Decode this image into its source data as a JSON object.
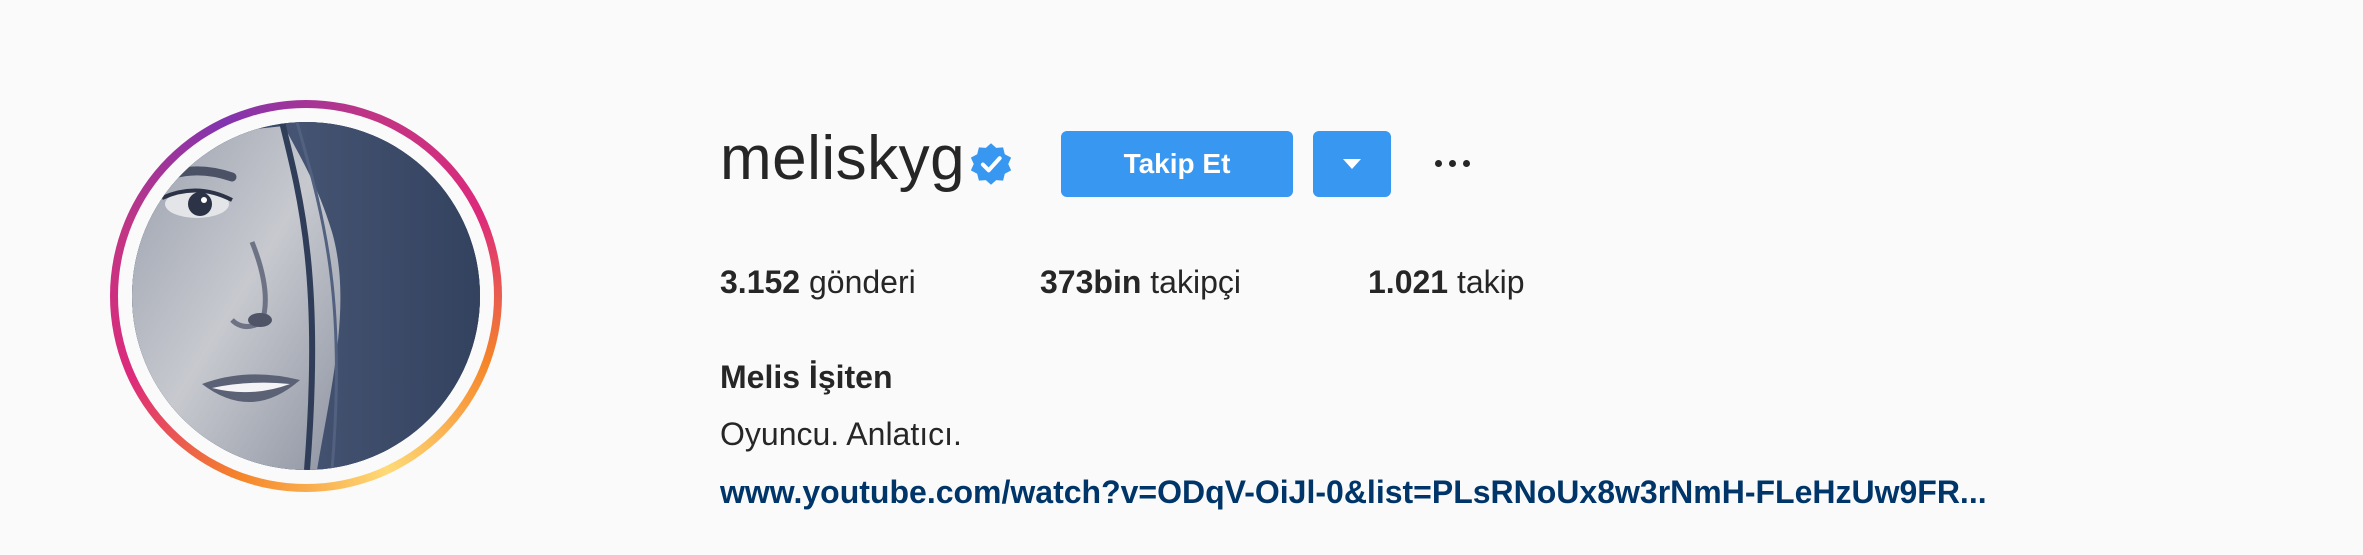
{
  "profile": {
    "username": "meliskyg",
    "verified": true,
    "full_name": "Melis İşiten",
    "bio": "Oyuncu. Anlatıcı.",
    "link": "www.youtube.com/watch?v=ODqV-OiJl-0&list=PLsRNoUx8w3rNmH-FLeHzUw9FR...",
    "avatar_icon": "profile-photo"
  },
  "actions": {
    "follow_label": "Takip Et",
    "dropdown_icon": "chevron-down-icon",
    "options_icon": "more-options-icon"
  },
  "stats": {
    "posts_count": "3.152",
    "posts_label": "gönderi",
    "followers_count": "373bin",
    "followers_label": "takipçi",
    "following_count": "1.021",
    "following_label": "takip"
  },
  "colors": {
    "accent": "#3897f0",
    "link": "#003569",
    "text": "#262626",
    "background": "#fafafa"
  }
}
